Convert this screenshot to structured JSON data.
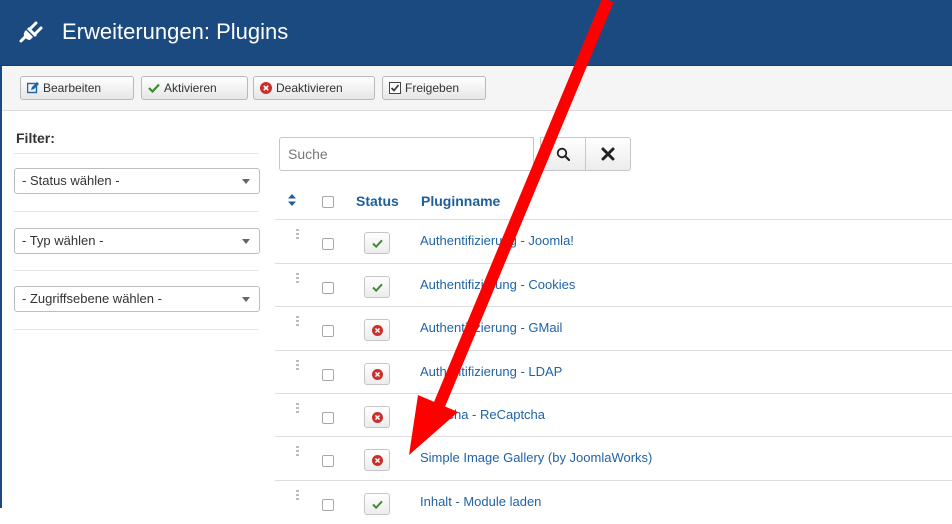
{
  "header": {
    "title": "Erweiterungen: Plugins",
    "icon": "plug-icon"
  },
  "toolbar": {
    "edit_label": "Bearbeiten",
    "enable_label": "Aktivieren",
    "disable_label": "Deaktivieren",
    "checkin_label": "Freigeben"
  },
  "filter": {
    "title": "Filter:",
    "status": "- Status wählen -",
    "type": "- Typ wählen -",
    "access": "- Zugriffsebene wählen -"
  },
  "search": {
    "placeholder": "Suche"
  },
  "table": {
    "col_status": "Status",
    "col_name": "Pluginname",
    "rows": [
      {
        "name": "Authentifizierung - Joomla!",
        "enabled": true
      },
      {
        "name": "Authentifizierung - Cookies",
        "enabled": true
      },
      {
        "name": "Authentifizierung - GMail",
        "enabled": false
      },
      {
        "name": "Authentifizierung - LDAP",
        "enabled": false
      },
      {
        "name": "Captcha - ReCaptcha",
        "enabled": false
      },
      {
        "name": "Simple Image Gallery (by JoomlaWorks)",
        "enabled": false
      },
      {
        "name": "Inhalt - Module laden",
        "enabled": true
      }
    ]
  },
  "colors": {
    "header_bg": "#1b4a80",
    "link": "#1f63a6",
    "annotation_arrow": "#ff0000",
    "enabled": "#3c8c2f",
    "disabled": "#c9302c"
  }
}
